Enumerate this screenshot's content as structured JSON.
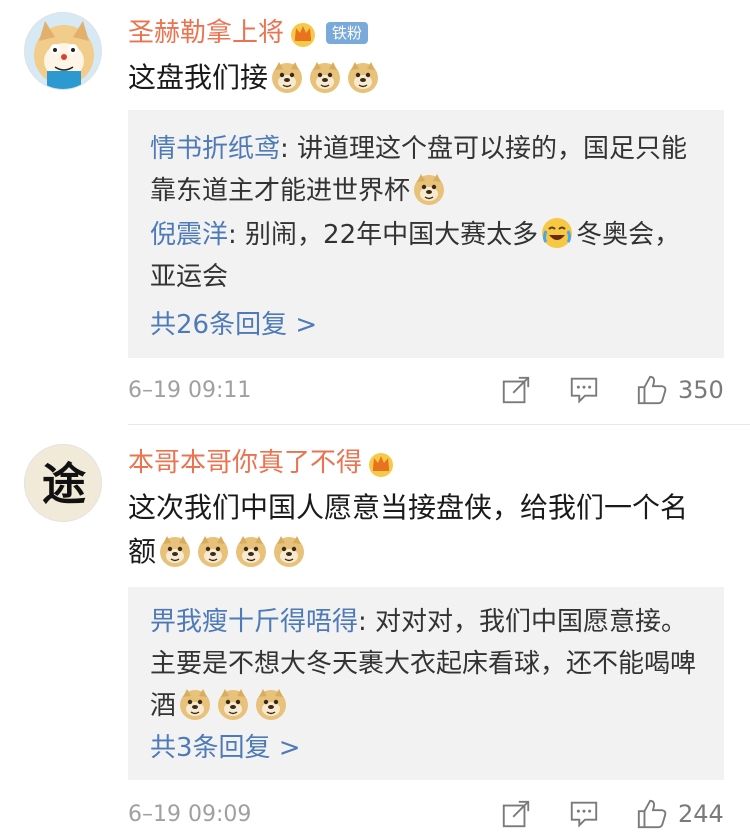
{
  "comments": [
    {
      "username": "圣赫勒拿上将",
      "fan_badge": "铁粉",
      "text": "这盘我们接",
      "text_emoji_count": 3,
      "replies": [
        {
          "name": "情书折纸鸢",
          "sep": ": ",
          "text": "讲道理这个盘可以接的，国足只能靠东道主才能进世界杯",
          "emoji": [
            "doge"
          ]
        },
        {
          "name": "倪震洋",
          "sep": ": ",
          "text_a": "别闹，22年中国大赛太多",
          "text_b": "冬奥会，亚运会"
        }
      ],
      "more_replies": "共26条回复 >",
      "time": "6–19 09:11",
      "likes": "350",
      "icons": [
        "share-icon",
        "comment-icon",
        "like-icon"
      ]
    },
    {
      "username": "本哥本哥你真了不得",
      "text": "这次我们中国人愿意当接盘侠，给我们一个名额",
      "text_emoji_count": 4,
      "replies": [
        {
          "name": "畀我瘦十斤得唔得",
          "sep": ": ",
          "text": "对对对，我们中国愿意接。主要是不想大冬天裹大衣起床看球，还不能喝啤酒",
          "emoji_count": 3
        }
      ],
      "more_replies": "共3条回复 >",
      "time": "6–19 09:09",
      "likes": "244",
      "icons": [
        "share-icon",
        "comment-icon",
        "like-icon"
      ]
    }
  ],
  "colors": {
    "username": "#eb7350",
    "reply_name": "#4e7bb8",
    "reply_bg": "#f2f2f2",
    "time": "#a0a0a0",
    "fan_badge": "#7aaad9"
  }
}
